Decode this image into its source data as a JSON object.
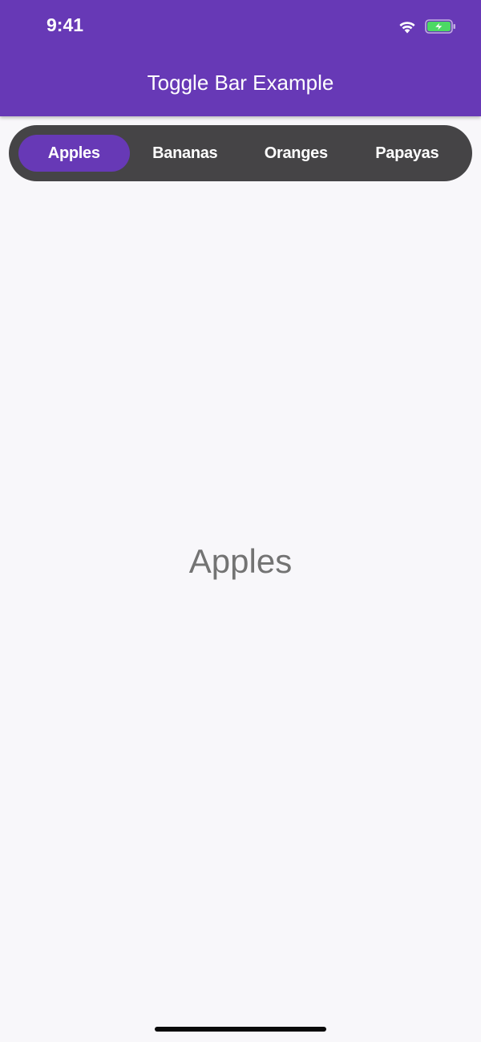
{
  "status_bar": {
    "time": "9:41",
    "icons": [
      "wifi-icon",
      "battery-charging-icon"
    ],
    "battery_fill_color": "#4CD964"
  },
  "app_bar": {
    "title": "Toggle Bar Example",
    "color": "#6739B6"
  },
  "toggle_bar": {
    "items": [
      {
        "label": "Apples"
      },
      {
        "label": "Bananas"
      },
      {
        "label": "Oranges"
      },
      {
        "label": "Papayas"
      }
    ],
    "selected": "Apples",
    "bar_color": "#454446",
    "selected_color": "#6739B6"
  },
  "content": {
    "label": "Apples"
  }
}
